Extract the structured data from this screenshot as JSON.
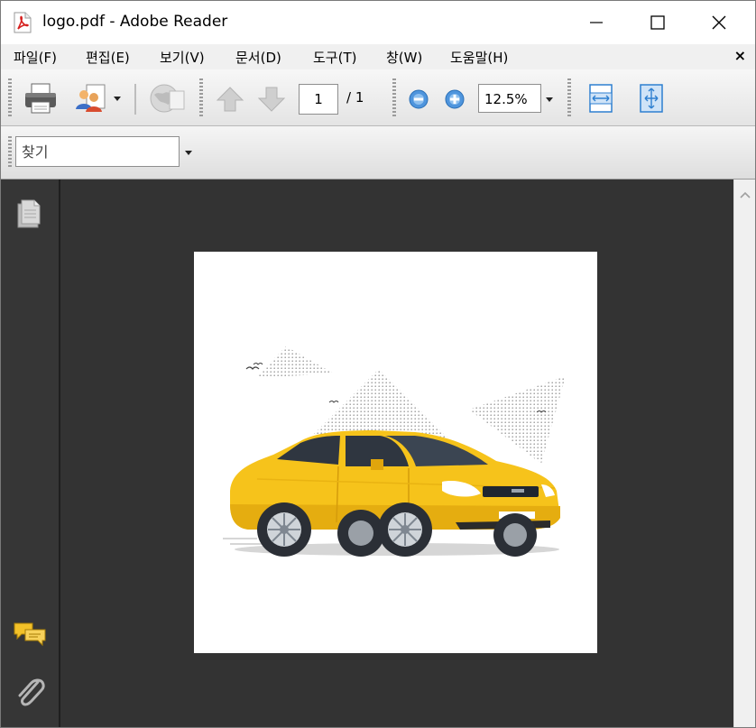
{
  "window": {
    "title": "logo.pdf - Adobe Reader"
  },
  "menu": {
    "items": [
      "파일(F)",
      "편집(E)",
      "보기(V)",
      "문서(D)",
      "도구(T)",
      "창(W)",
      "도움말(H)"
    ],
    "close_symbol": "×"
  },
  "toolbar": {
    "page_current": "1",
    "page_total": "/ 1",
    "zoom": "12.5%",
    "icons": [
      "print-icon",
      "collaborate-icon",
      "email-icon",
      "previous-page-icon",
      "next-page-icon",
      "zoom-out-icon",
      "zoom-in-icon",
      "fit-width-icon",
      "fit-page-icon"
    ]
  },
  "find": {
    "value": "찾기"
  },
  "sidebar": {
    "icons": [
      "pages-icon",
      "comments-icon",
      "attachments-icon"
    ]
  },
  "document": {
    "content": "car illustration"
  },
  "colors": {
    "canvas": "#333333",
    "car": "#f6c31b",
    "accent_blue": "#2d7fd0"
  }
}
